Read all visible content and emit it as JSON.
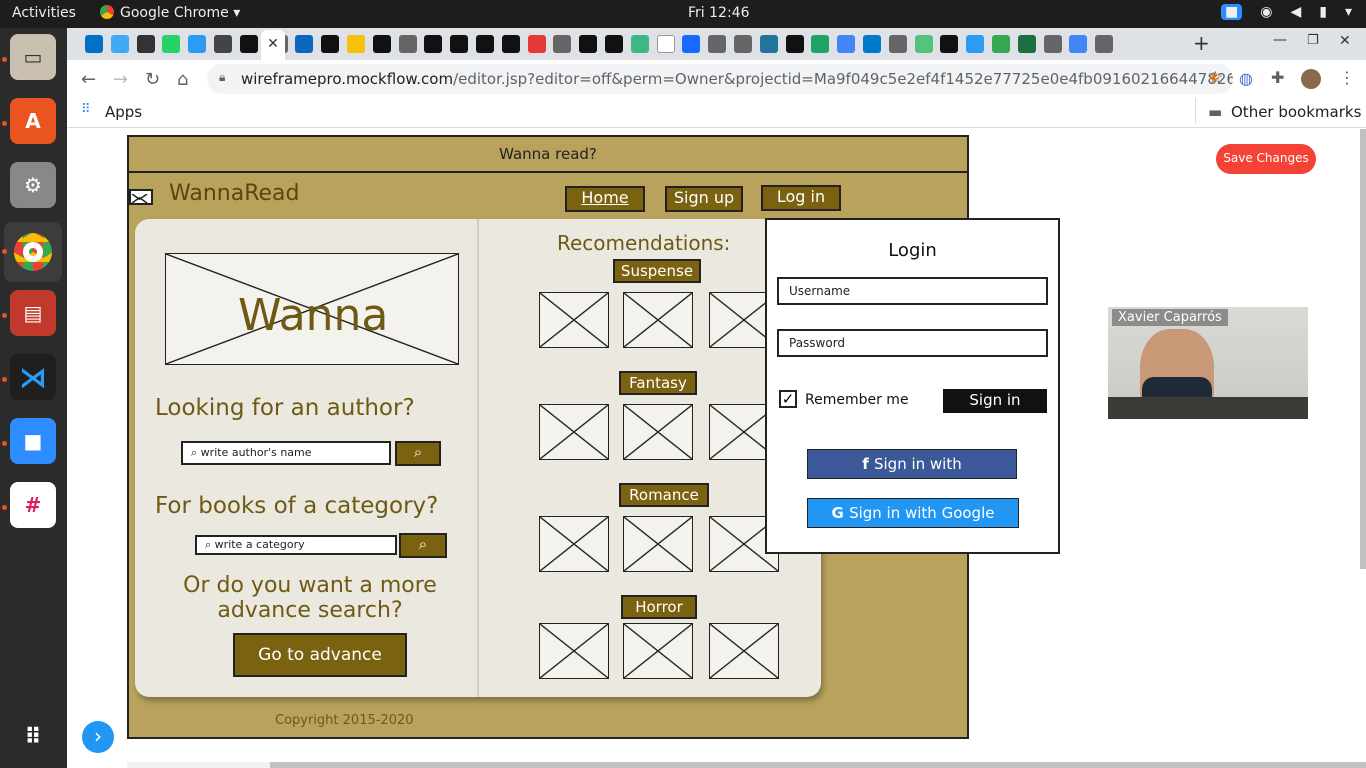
{
  "os": {
    "activities": "Activities",
    "app_name": "Google Chrome",
    "app_caret": "▾",
    "clock": "Fri 12:46"
  },
  "browser": {
    "url_host": "wireframepro.mockflow.com",
    "url_path": "/editor.jsp?editor=off&perm=Owner&projectid=Ma9f049c5e2ef4f1452e77725e0e4fb091602166447826&publici...",
    "apps_label": "Apps",
    "other_bookmarks": "Other bookmarks"
  },
  "editor": {
    "save_label": "Save Changes"
  },
  "wire": {
    "top_title": "Wanna read?",
    "brand": "WannaRead",
    "nav": [
      "Home",
      "Sign up",
      "Log in"
    ],
    "hero_text": "Wanna",
    "author_q": "Looking for an author?",
    "author_placeholder": "write author's name",
    "category_q": "For books of a category?",
    "category_placeholder": "write a category",
    "advance_q": "Or do you want a more advance search?",
    "advance_btn": "Go to advance",
    "rec_title": "Recomendations:",
    "categories": [
      "Suspense",
      "Fantasy",
      "Romance",
      "Horror"
    ],
    "copyright": "Copyright 2015-2020"
  },
  "login": {
    "title": "Login",
    "username": "Username",
    "password": "Password",
    "remember": "Remember me",
    "signin": "Sign in",
    "facebook": "Sign in with",
    "google": "Sign in with Google"
  },
  "video": {
    "participant": "Xavier Caparrós"
  }
}
